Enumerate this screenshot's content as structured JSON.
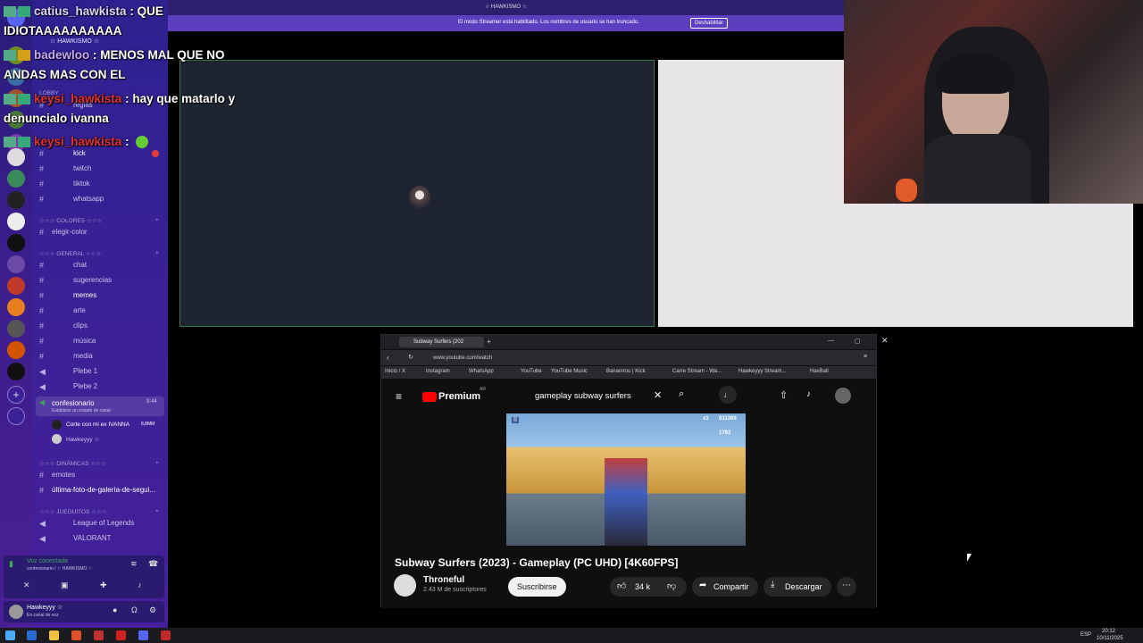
{
  "chat_overlay": {
    "messages": [
      {
        "user": "catius_hawkista",
        "sep": " : ",
        "text": "QUE",
        "cont": "IDIOTAAAAAAAAAA",
        "color": "#e8e8ff"
      },
      {
        "user": "badewloo",
        "sep": " : ",
        "text": "MENOS MAL QUE NO",
        "cont": "ANDAS MAS CON EL",
        "color": "#c9a7ff"
      },
      {
        "user": "keysi_hawkista",
        "sep": " : ",
        "text": "hay que matarlo y",
        "cont": "denuncialo ivanna",
        "color": "#e03030"
      },
      {
        "user": "keysi_hawkista",
        "sep": " : ",
        "text": "",
        "cont": "",
        "color": "#e03030"
      }
    ]
  },
  "discord": {
    "server_name": "☆ HAWKISMO ☆",
    "streamer_banner": "El modo Streamer está habilitado. Los nombres de usuario se han truncado.",
    "streamer_button": "Deshabilitar",
    "categories": {
      "lobby": "LOBBY",
      "colores": "☆☆☆ COLORES ☆☆☆",
      "general": "☆☆☆ GENERAL ☆☆☆",
      "dinamicas": "☆☆☆ DINÁMICAS ☆☆☆",
      "juegos": "☆☆☆ JUEGUITOS ☆☆☆"
    },
    "channels": {
      "reglas": "reglas",
      "kick": "kick",
      "twitch": "twitch",
      "tiktok": "tiktok",
      "whatsapp": "whatsapp",
      "elegir_color": "elegir-color",
      "chat": "chat",
      "sugerencias": "sugerencias",
      "memes": "memes",
      "arte": "arte",
      "clips": "clips",
      "musica": "música",
      "media": "media",
      "plebe1": "Plebe 1",
      "plebe2": "Plebe 2",
      "confesionario": "confesionario",
      "confesionario_status": "Establece un estado de canal",
      "confesionario_time": "9:44",
      "emotes": "emotes",
      "ultima_foto": "última-foto-de-galería-de-segui...",
      "lol": "League of Legends",
      "valorant": "VALORANT"
    },
    "voice_users": [
      {
        "name": "Corte con mi ex IVANNA",
        "badge": "8,8MM"
      },
      {
        "name": "Hawkeyyy ☆",
        "badge": ""
      }
    ],
    "voice_status": "Voz conectada",
    "voice_channel": "confesionario / ☆ HAWKISMO ☆",
    "user_name": "Hawkeyyy ☆",
    "user_status": "En canal de voz"
  },
  "browser": {
    "tab_title": "Subway Surfers (202",
    "url": "www.youtube.com/watch",
    "bookmarks": [
      "Inicio / X",
      "Instagram",
      "WhatsApp",
      "YouTube",
      "YouTube Music",
      "Bananirou | Kick",
      "Carre Stream - Wa...",
      "Hawkeyyy Stream...",
      "HaxBall"
    ],
    "yt_logo": "Premium",
    "yt_region": "AR",
    "search_value": "gameplay subway surfers",
    "video_title": "Subway Surfers (2023) - Gameplay (PC UHD) [4K60FPS]",
    "channel_name": "Throneful",
    "subscribers": "2.43 M de suscriptores",
    "subscribe_label": "Suscribirse",
    "likes": "34 k",
    "share_label": "Compartir",
    "download_label": "Descargar",
    "game_score": "011369",
    "game_coins": "1783",
    "game_mult": "x1"
  },
  "taskbar": {
    "lang": "ESP",
    "time": "20:12",
    "date": "10/11/2025"
  },
  "colors": {
    "discord_accent": "#5b3fbf",
    "yt_red": "#ff0000",
    "active_speaker_border": "#3a7a44"
  }
}
